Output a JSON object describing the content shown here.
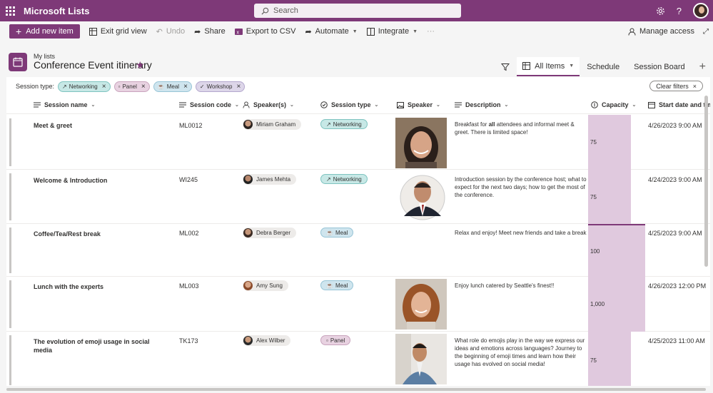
{
  "app": {
    "title": "Microsoft Lists",
    "search_placeholder": "Search"
  },
  "commands": {
    "add_new_item": "Add new item",
    "exit_grid_view": "Exit grid view",
    "undo": "Undo",
    "share": "Share",
    "export_csv": "Export to CSV",
    "automate": "Automate",
    "integrate": "Integrate",
    "more": "···",
    "manage_access": "Manage access"
  },
  "list": {
    "breadcrumb": "My lists",
    "title": "Conference Event itinerary"
  },
  "views": {
    "all_items": "All Items",
    "schedule": "Schedule",
    "session_board": "Session Board"
  },
  "filters": {
    "label": "Session type:",
    "chips": [
      "Networking",
      "Panel",
      "Meal",
      "Workshop"
    ],
    "clear": "Clear filters"
  },
  "columns": {
    "session_name": "Session name",
    "session_code": "Session code",
    "speakers": "Speaker(s)",
    "session_type": "Session type",
    "speaker": "Speaker",
    "description": "Description",
    "capacity": "Capacity",
    "start": "Start date and tim"
  },
  "rows": [
    {
      "name": "Meet & greet",
      "code": "ML0012",
      "speaker": "Miriam Graham",
      "type": "Networking",
      "desc_pre": "Breakfast for ",
      "desc_bold": "all",
      "desc_post": " attendees and informal meet & greet. There is limited space!",
      "capacity": "75",
      "start": "4/26/2023 9:00 AM"
    },
    {
      "name": "Welcome & Introduction",
      "code": "WI245",
      "speaker": "James Mehta",
      "type": "Networking",
      "desc_pre": "Introduction session by the conference host; what to expect for the next two days; how to get the most of the conference.",
      "desc_bold": "",
      "desc_post": "",
      "capacity": "75",
      "start": "4/24/2023 9:00 AM"
    },
    {
      "name": "Coffee/Tea/Rest break",
      "code": "ML002",
      "speaker": "Debra Berger",
      "type": "Meal",
      "desc_pre": "Relax and enjoy! Meet new friends and take a break",
      "desc_bold": "",
      "desc_post": "",
      "capacity": "100",
      "start": "4/25/2023 9:00 AM"
    },
    {
      "name": "Lunch with the experts",
      "code": "ML003",
      "speaker": "Amy Sung",
      "type": "Meal",
      "desc_pre": "Enjoy lunch catered by Seattle's finest!!",
      "desc_bold": "",
      "desc_post": "",
      "capacity": "1,000",
      "start": "4/26/2023 12:00 PM"
    },
    {
      "name": "The evolution of emoji usage in social media",
      "code": "TK173",
      "speaker": "Alex Wilber",
      "type": "Panel",
      "desc_pre": "What role do emojis play in the way we express our ideas and emotions across languages? Journey to the beginning of emoji times and learn how their usage has evolved on social media!",
      "desc_bold": "",
      "desc_post": "",
      "capacity": "75",
      "start": "4/25/2023 11:00 AM"
    }
  ],
  "colors": {
    "brand": "#7e3978",
    "capacity_fill": "#e0c9de"
  }
}
